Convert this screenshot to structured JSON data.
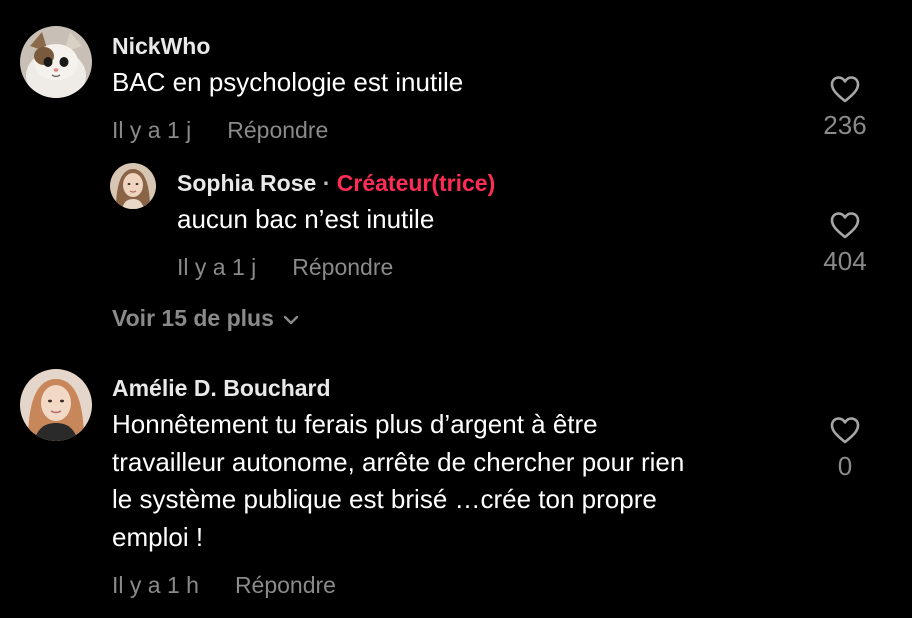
{
  "comments": [
    {
      "username": "NickWho",
      "text": "BAC en psychologie est inutile",
      "time": "Il y a 1 j",
      "reply_label": "Répondre",
      "likes": "236",
      "replies": [
        {
          "username": "Sophia Rose",
          "separator": "·",
          "badge": "Créateur(trice)",
          "text": "aucun bac n’est inutile",
          "time": "Il y a 1 j",
          "reply_label": "Répondre",
          "likes": "404"
        }
      ],
      "view_more_label": "Voir 15 de plus"
    },
    {
      "username": "Amélie D. Bouchard",
      "text_lines": [
        "Honnêtement tu ferais plus d’argent à être",
        "travailleur autonome, arrête de chercher pour rien",
        "le système publique est brisé …crée ton propre",
        "emploi !"
      ],
      "time": "Il y a 1 h",
      "reply_label": "Répondre",
      "likes": "0"
    }
  ],
  "colors": {
    "background": "#000000",
    "primary_text": "#ffffff",
    "secondary_text": "#8a8a8a",
    "creator_badge": "#fe2c55"
  },
  "icons": {
    "like": "heart-outline-icon",
    "expand": "chevron-down-icon"
  }
}
